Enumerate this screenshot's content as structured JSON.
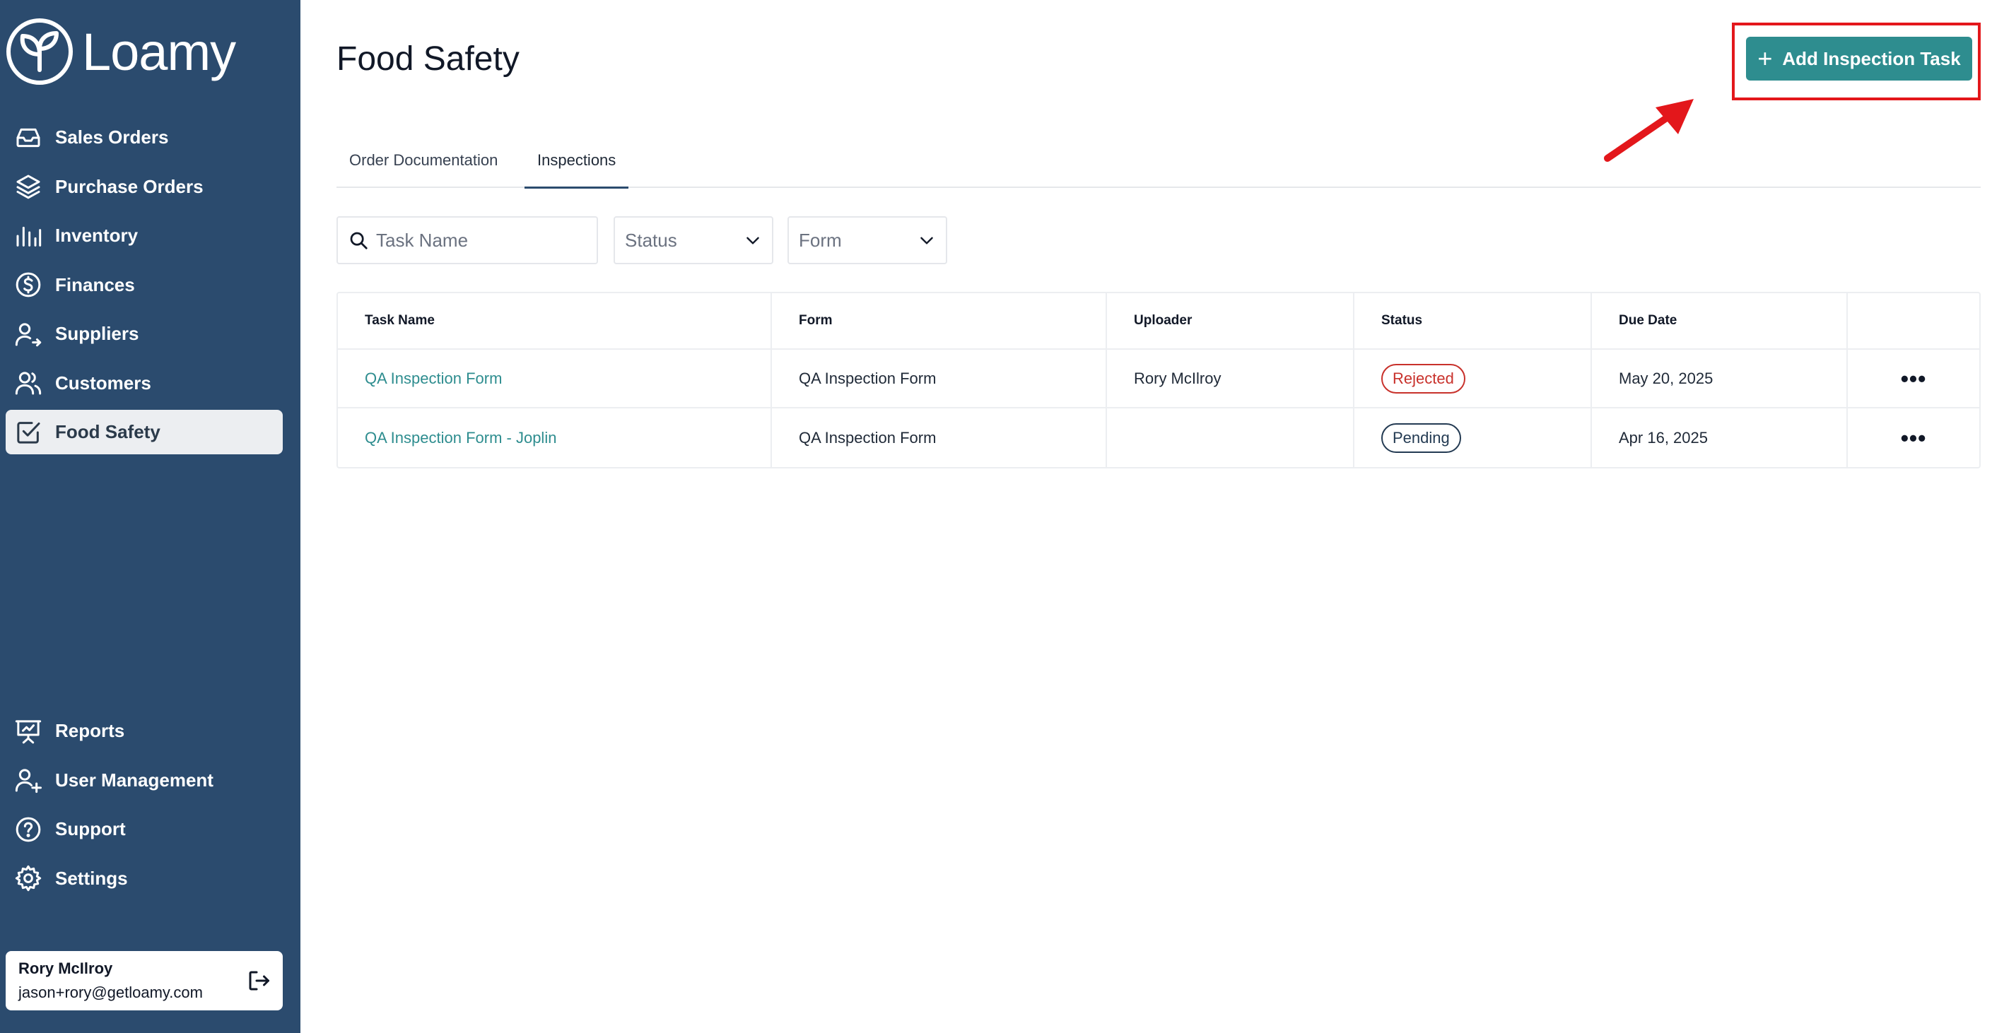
{
  "brand": {
    "name": "Loamy"
  },
  "sidebar": {
    "top_items": [
      {
        "label": "Sales Orders",
        "icon": "inbox-icon"
      },
      {
        "label": "Purchase Orders",
        "icon": "layers-icon"
      },
      {
        "label": "Inventory",
        "icon": "bar-chart-icon"
      },
      {
        "label": "Finances",
        "icon": "dollar-circle-icon"
      },
      {
        "label": "Suppliers",
        "icon": "user-arrow-icon"
      },
      {
        "label": "Customers",
        "icon": "users-icon"
      },
      {
        "label": "Food Safety",
        "icon": "check-square-icon",
        "active": true
      }
    ],
    "bottom_items": [
      {
        "label": "Reports",
        "icon": "presentation-icon"
      },
      {
        "label": "User Management",
        "icon": "user-plus-icon"
      },
      {
        "label": "Support",
        "icon": "help-circle-icon"
      },
      {
        "label": "Settings",
        "icon": "gear-icon"
      }
    ],
    "user": {
      "name": "Rory McIlroy",
      "email": "jason+rory@getloamy.com"
    }
  },
  "page": {
    "title": "Food Safety",
    "add_button_label": "Add Inspection Task"
  },
  "tabs": [
    {
      "label": "Order Documentation"
    },
    {
      "label": "Inspections",
      "active": true
    }
  ],
  "filters": {
    "search_placeholder": "Task Name",
    "status_placeholder": "Status",
    "form_placeholder": "Form"
  },
  "table": {
    "headers": [
      "Task Name",
      "Form",
      "Uploader",
      "Status",
      "Due Date",
      ""
    ],
    "rows": [
      {
        "task_name": "QA Inspection Form",
        "form": "QA Inspection Form",
        "uploader": "Rory McIlroy",
        "status": "Rejected",
        "due_date": "May 20, 2025"
      },
      {
        "task_name": "QA Inspection Form - Joplin",
        "form": "QA Inspection Form",
        "uploader": "",
        "status": "Pending",
        "due_date": "Apr 16, 2025"
      }
    ]
  },
  "colors": {
    "sidebar_bg": "#2b4b6e",
    "accent": "#2e8d8f",
    "rejected": "#c8312b",
    "highlight": "#e3171b"
  }
}
